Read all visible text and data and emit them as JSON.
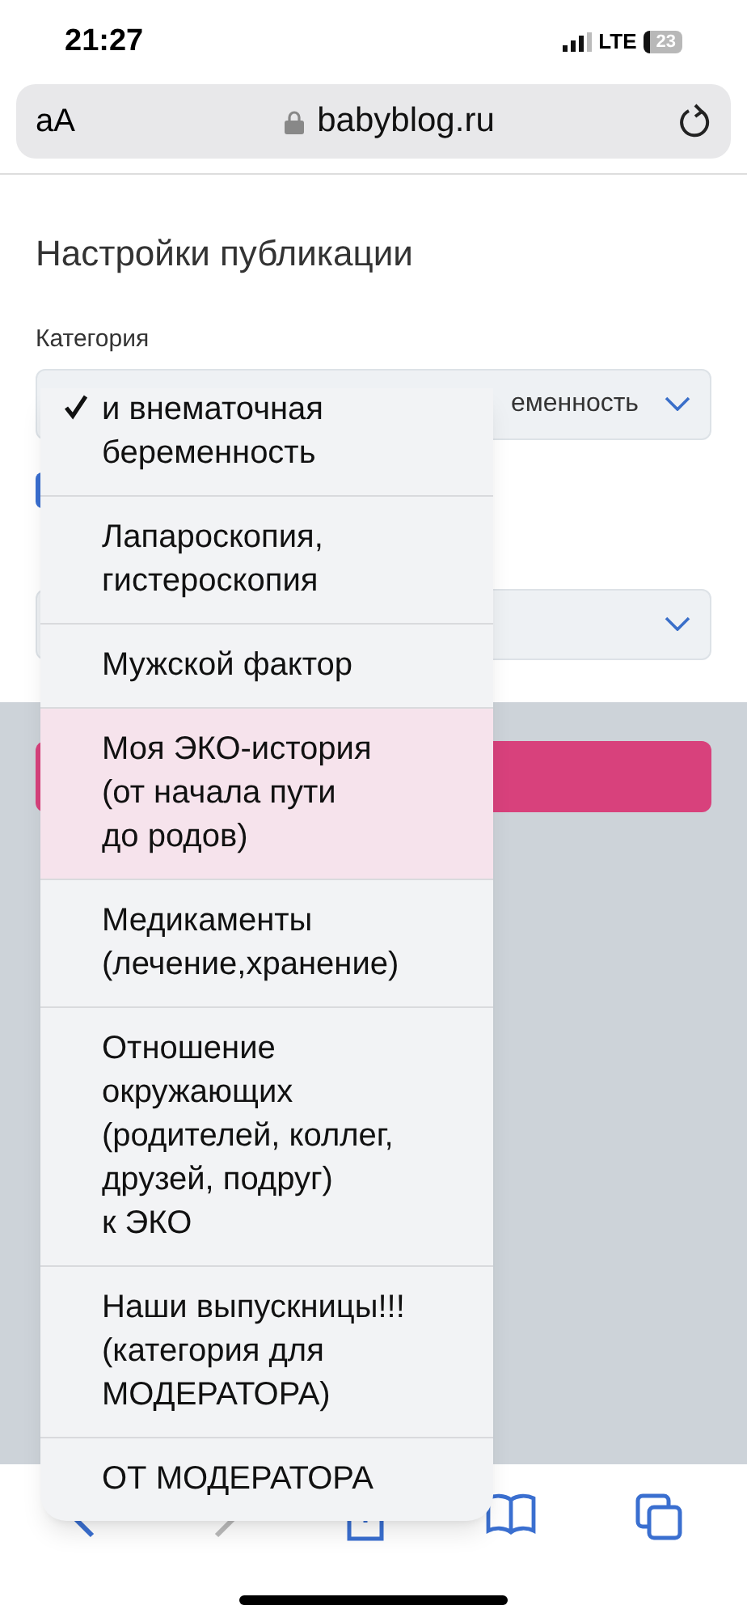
{
  "status_bar": {
    "time": "21:27",
    "network": "LTE",
    "battery": "23"
  },
  "address_bar": {
    "text_size": "aA",
    "url": "babyblog.ru"
  },
  "page": {
    "title": "Настройки публикации",
    "category_label": "Категория",
    "category_value": "еменность"
  },
  "dropdown": {
    "items": [
      {
        "label": "и внематочная\nбеременность",
        "selected": true
      },
      {
        "label": "Лапароскопия,\nгистероскопия",
        "selected": false
      },
      {
        "label": "Мужской фактор",
        "selected": false
      },
      {
        "label": "Моя ЭКО-история\n(от начала пути\nдо родов)",
        "selected": false
      },
      {
        "label": "Медикаменты\n(лечение,хранение)",
        "selected": false
      },
      {
        "label": "Отношение\nокружающих\n(родителей, коллег,\nдрузей, подруг)\nк ЭКО",
        "selected": false
      },
      {
        "label": "Наши выпускницы!!!\n(категория для\nМОДЕРАТОРА)",
        "selected": false
      },
      {
        "label": "ОТ МОДЕРАТОРА",
        "selected": false
      }
    ]
  }
}
